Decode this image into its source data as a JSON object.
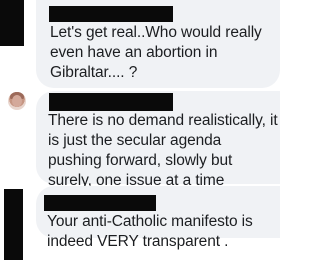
{
  "comments": [
    {
      "text": "Let's get real..Who would really even have an abortion in Gibraltar.... ?"
    },
    {
      "text": "There is no demand realistically, it is just the secular agenda pushing forward, slowly but surely, one issue at a time"
    },
    {
      "text": "Your anti-Catholic manifesto is indeed VERY transparent ."
    }
  ],
  "colors": {
    "bubble": "#f0f2f5",
    "text": "#1c1e21",
    "redaction": "#0a0a0a"
  }
}
